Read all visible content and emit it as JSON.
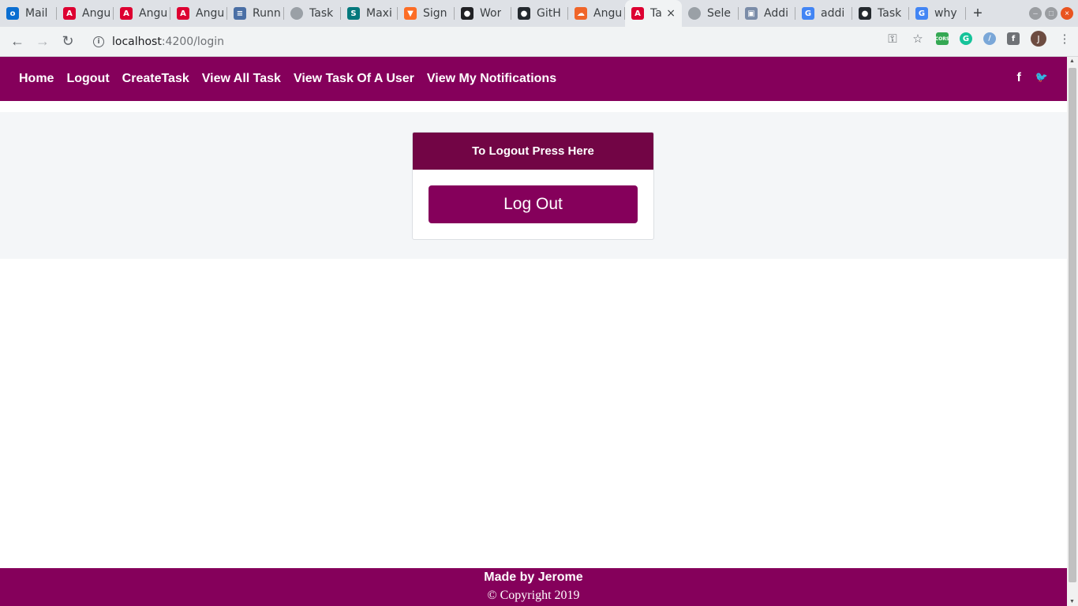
{
  "browser": {
    "tabs": [
      {
        "title": "Mail",
        "favicon": "outlook-icon",
        "color": "#0a6ed1",
        "glyph": "o"
      },
      {
        "title": "Angu",
        "favicon": "angular-icon",
        "color": "#dd0031",
        "glyph": "A"
      },
      {
        "title": "Angu",
        "favicon": "angular-icon",
        "color": "#dd0031",
        "glyph": "A"
      },
      {
        "title": "Angu",
        "favicon": "angular-icon",
        "color": "#dd0031",
        "glyph": "A"
      },
      {
        "title": "Runn",
        "favicon": "document-icon",
        "color": "#4a6fa5",
        "glyph": "≡"
      },
      {
        "title": "Task",
        "favicon": "globe-icon",
        "color": "#9aa0a6",
        "glyph": ""
      },
      {
        "title": "Maxi",
        "favicon": "sharepoint-icon",
        "color": "#03787c",
        "glyph": "S"
      },
      {
        "title": "Sign",
        "favicon": "gitlab-icon",
        "color": "#fc6d26",
        "glyph": "▼"
      },
      {
        "title": "Wor",
        "favicon": "owl-icon",
        "color": "#202124",
        "glyph": "●"
      },
      {
        "title": "GitH",
        "favicon": "github-icon",
        "color": "#24292e",
        "glyph": "●"
      },
      {
        "title": "Angu",
        "favicon": "stackblitz-icon",
        "color": "#f06529",
        "glyph": "☁"
      },
      {
        "title": "Ta",
        "favicon": "angular-icon",
        "color": "#dd0031",
        "glyph": "A",
        "active": true
      },
      {
        "title": "Sele",
        "favicon": "globe-icon",
        "color": "#9aa0a6",
        "glyph": ""
      },
      {
        "title": "Addi",
        "favicon": "image-icon",
        "color": "#7a8ca8",
        "glyph": "▣"
      },
      {
        "title": "addi",
        "favicon": "google-icon",
        "color": "#4285f4",
        "glyph": "G"
      },
      {
        "title": "Task",
        "favicon": "github-icon",
        "color": "#24292e",
        "glyph": "●"
      },
      {
        "title": "why",
        "favicon": "google-icon",
        "color": "#4285f4",
        "glyph": "G"
      }
    ],
    "new_tab": "+",
    "close_tab": "×",
    "url_host": "localhost",
    "url_path": ":4200/login"
  },
  "nav": {
    "links": [
      "Home",
      "Logout",
      "CreateTask",
      "View All Task",
      "View Task Of A User",
      "View My Notifications"
    ],
    "facebook": "f",
    "twitter": "🐦"
  },
  "card": {
    "header": "To Logout Press Here",
    "button": "Log Out"
  },
  "footer": {
    "made_by": "Made by Jerome",
    "copyright": "© Copyright 2019"
  },
  "user": {
    "initial": "J"
  },
  "colors": {
    "brand": "#85005b",
    "card_header": "#720545",
    "band": "#f4f6f8"
  }
}
